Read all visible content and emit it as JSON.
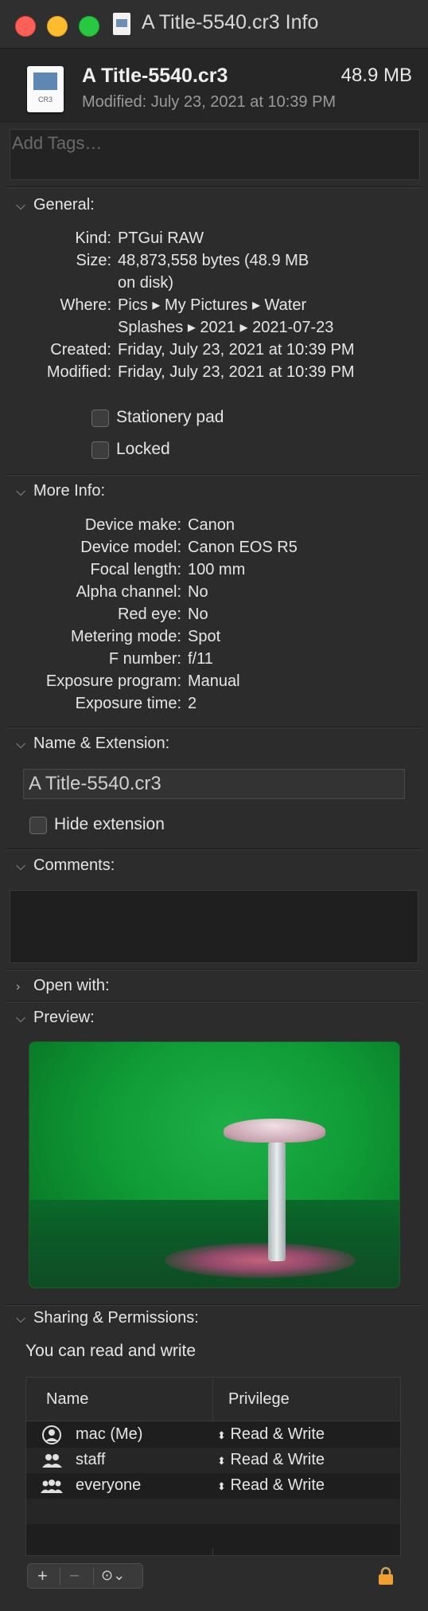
{
  "window": {
    "title": "A Title-5540.cr3 Info"
  },
  "header": {
    "icon_ext": "CR3",
    "file_name": "A Title-5540.cr3",
    "file_size": "48.9 MB",
    "modified": "Modified:  July 23, 2021 at 10:39 PM"
  },
  "tags": {
    "placeholder": "Add Tags…"
  },
  "general": {
    "title": "General:",
    "kind_label": "Kind:",
    "kind": "PTGui RAW",
    "size_label": "Size:",
    "size_line1": "48,873,558 bytes (48.9 MB",
    "size_line2": "on disk)",
    "where_label": "Where:",
    "where_line1": "Pics ▸ My Pictures ▸ Water",
    "where_line2": "Splashes ▸ 2021 ▸ 2021-07-23",
    "created_label": "Created:",
    "created": "Friday, July 23, 2021 at 10:39 PM",
    "modified_label": "Modified:",
    "modified": "Friday, July 23, 2021 at 10:39 PM",
    "stationery": "Stationery pad",
    "locked": "Locked"
  },
  "more_info": {
    "title": "More Info:",
    "rows": [
      {
        "k": "Device make:",
        "v": "Canon"
      },
      {
        "k": "Device model:",
        "v": "Canon EOS R5"
      },
      {
        "k": "Focal length:",
        "v": "100 mm"
      },
      {
        "k": "Alpha channel:",
        "v": "No"
      },
      {
        "k": "Red eye:",
        "v": "No"
      },
      {
        "k": "Metering mode:",
        "v": "Spot"
      },
      {
        "k": "F number:",
        "v": "f/11"
      },
      {
        "k": "Exposure program:",
        "v": "Manual"
      },
      {
        "k": "Exposure time:",
        "v": "2"
      }
    ]
  },
  "name_ext": {
    "title": "Name & Extension:",
    "value": "A Title-5540.cr3",
    "hide_ext": "Hide extension"
  },
  "comments": {
    "title": "Comments:"
  },
  "open_with": {
    "title": "Open with:"
  },
  "preview": {
    "title": "Preview:"
  },
  "sharing": {
    "title": "Sharing & Permissions:",
    "summary": "You can read and write",
    "col_name": "Name",
    "col_priv": "Privilege",
    "rows": [
      {
        "name": "mac (Me)",
        "priv": "Read & Write"
      },
      {
        "name": "staff",
        "priv": "Read & Write"
      },
      {
        "name": "everyone",
        "priv": "Read & Write"
      }
    ]
  }
}
